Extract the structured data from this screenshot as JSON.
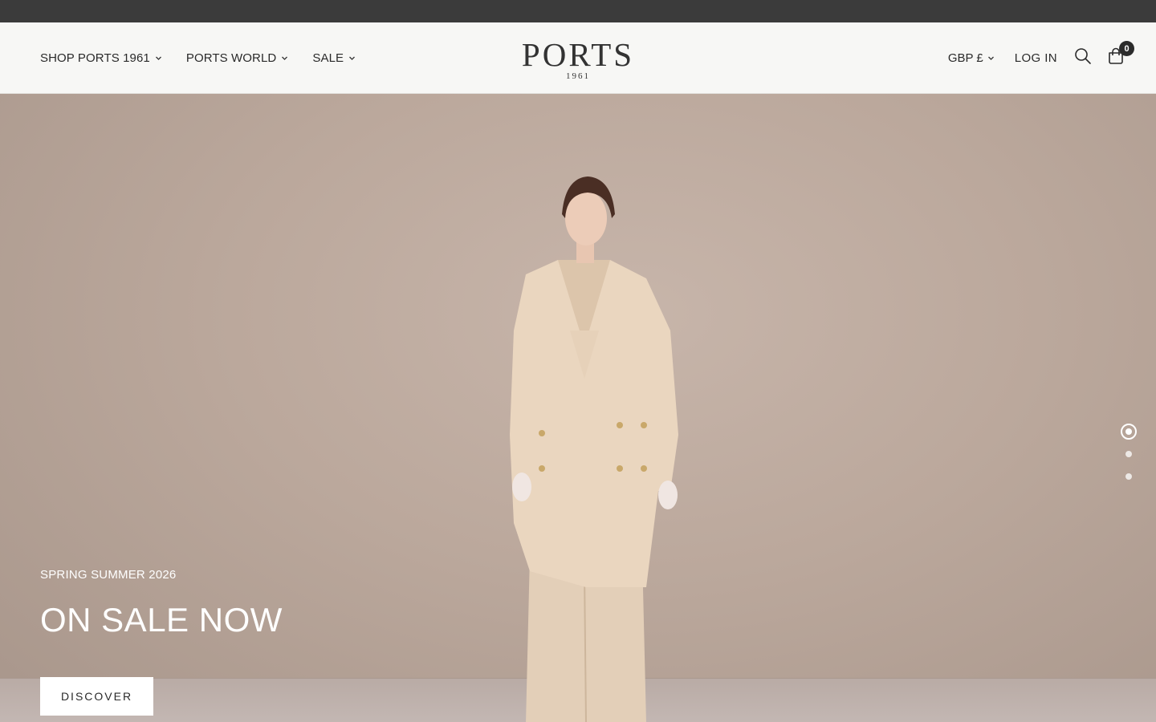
{
  "header": {
    "nav": [
      {
        "label": "SHOP PORTS 1961"
      },
      {
        "label": "PORTS WORLD"
      },
      {
        "label": "SALE"
      }
    ],
    "logo": {
      "main": "PORTS",
      "sub": "1961"
    },
    "currency": "GBP £",
    "login": "LOG IN",
    "cart_count": "0",
    "icons": {
      "search": "search-icon",
      "cart": "shopping-bag-icon",
      "dropdown": "chevron-down-icon"
    }
  },
  "hero": {
    "eyebrow": "SPRING SUMMER 2026",
    "title": "ON SALE NOW",
    "cta": "DISCOVER",
    "slides_total": 3,
    "active_slide": 1
  },
  "colors": {
    "top_bar": "#3b3b3b",
    "header_bg": "#f7f7f5",
    "hero_bg": "#bba89c",
    "text_dark": "#2a2a2a",
    "hero_text": "#ffffff"
  }
}
